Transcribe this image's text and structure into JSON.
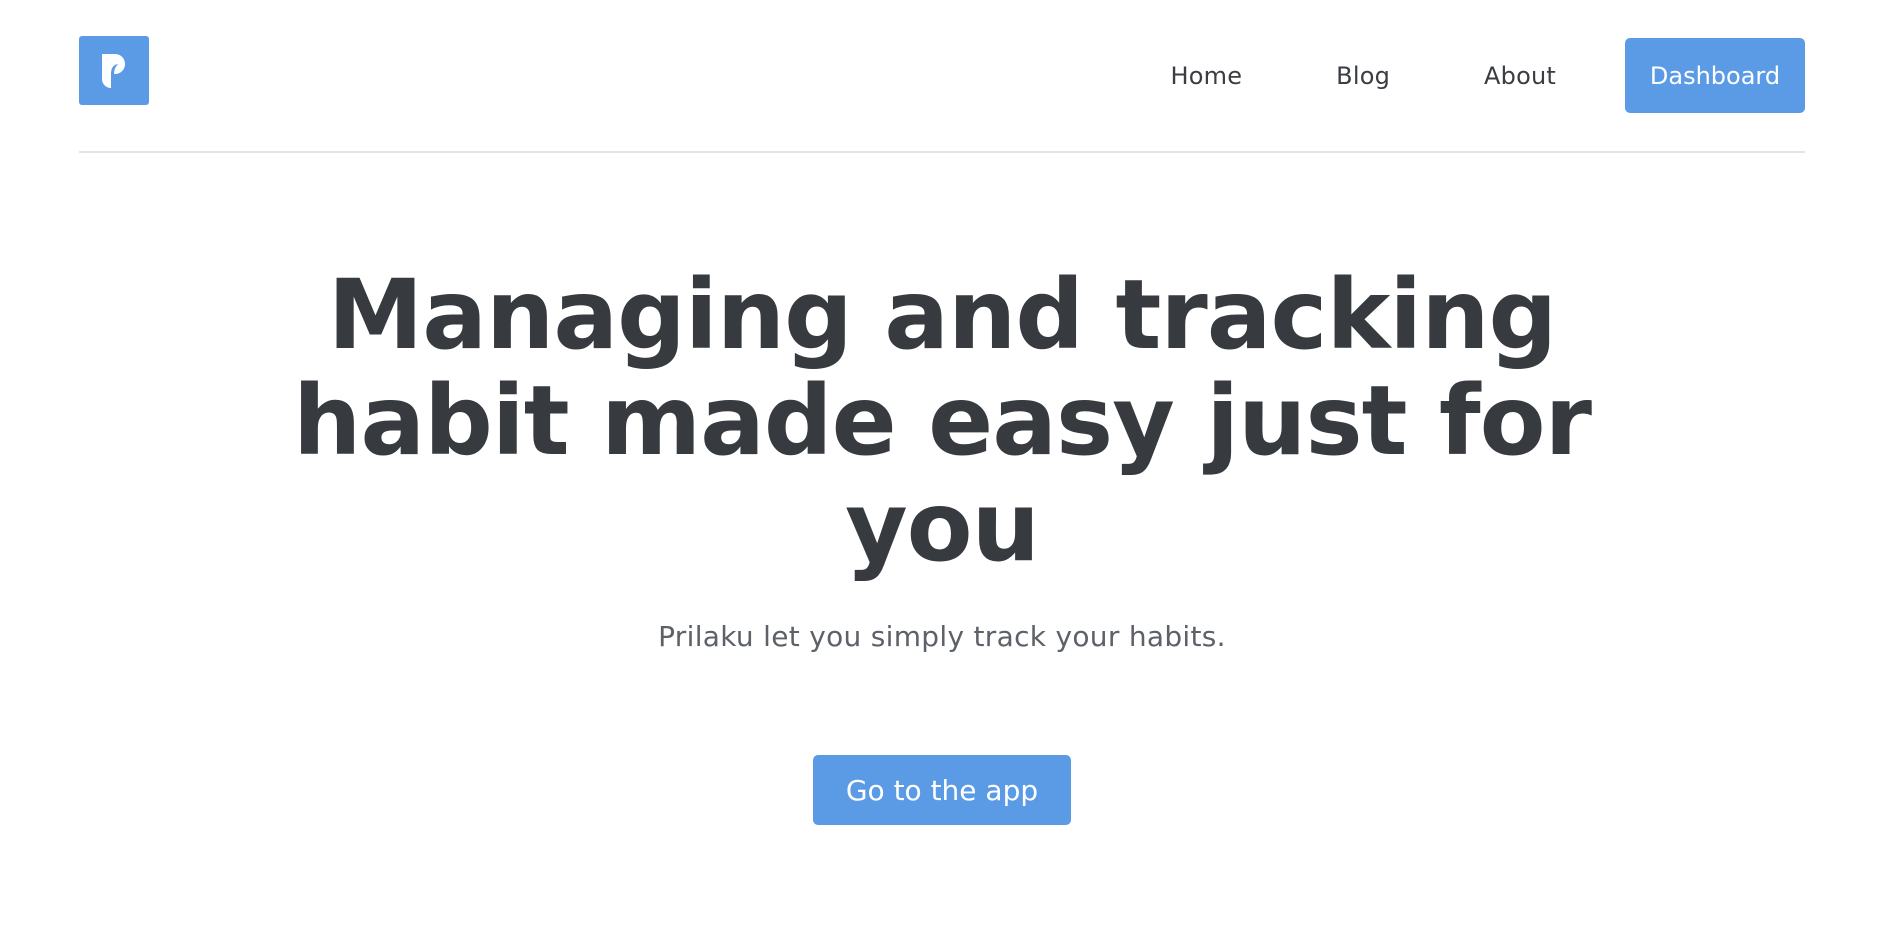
{
  "brand": {
    "logo_icon": "prilaku-logo-icon",
    "accent_color": "#5b9be6"
  },
  "nav": {
    "home": "Home",
    "blog": "Blog",
    "about": "About",
    "dashboard": "Dashboard"
  },
  "hero": {
    "title": "Managing and tracking habit made easy just for you",
    "subtitle": "Prilaku let you simply track your habits.",
    "cta": "Go to the app"
  }
}
